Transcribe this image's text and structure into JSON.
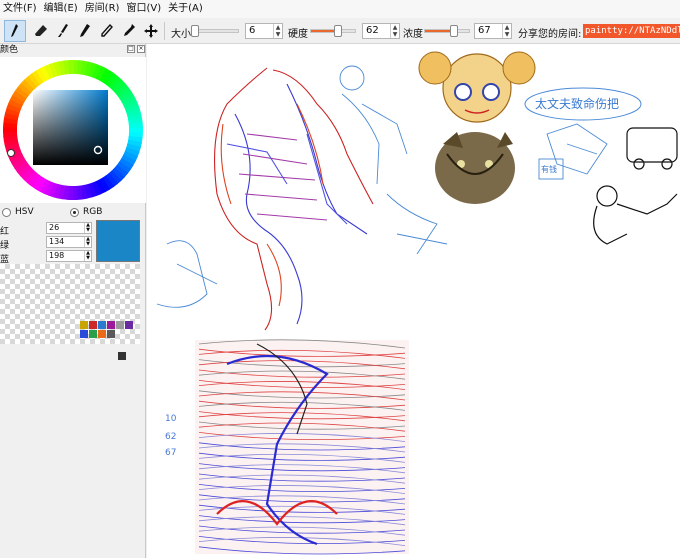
{
  "menu": [
    {
      "label": "文件(F)"
    },
    {
      "label": "编辑(E)"
    },
    {
      "label": "房间(R)"
    },
    {
      "label": "窗口(V)"
    },
    {
      "label": "关于(A)"
    }
  ],
  "toolbar": {
    "tools": [
      "pen-tool",
      "eraser-tool",
      "brush-tool",
      "marker-tool",
      "pencil-tool",
      "dropper-tool",
      "move-tool"
    ],
    "size_label": "大小",
    "size_value": "6",
    "size_level": 0.02,
    "hardness_label": "硬度",
    "hardness_value": "62",
    "hardness_level": 0.62,
    "opacity_label": "浓度",
    "opacity_value": "67",
    "opacity_level": 0.67,
    "share_label": "分享您的房间:",
    "room_url": "paintty://NTAzNDdlNWIy",
    "accent_color": "#e8692b"
  },
  "color_panel": {
    "title": "颜色",
    "mode_hsv": "HSV",
    "mode_rgb": "RGB",
    "selected_mode": "RGB",
    "red_label": "红",
    "red_value": "26",
    "green_label": "绿",
    "green_value": "134",
    "blue_label": "蓝",
    "blue_value": "198",
    "current_color": "#1a86c6",
    "palette": [
      "#c8a400",
      "#cc2a2a",
      "#2a7ad0",
      "#9a1a9a",
      "#9a9a9a",
      "#6a2aa0",
      "#2a4ad8",
      "#2aa04a",
      "#e86a1a",
      "#5a5a5a"
    ]
  },
  "canvas": {
    "handwritten_text": "太文夫致命伤把",
    "note_numbers": [
      "10",
      "62",
      "67"
    ],
    "sign_text": "有钱"
  }
}
